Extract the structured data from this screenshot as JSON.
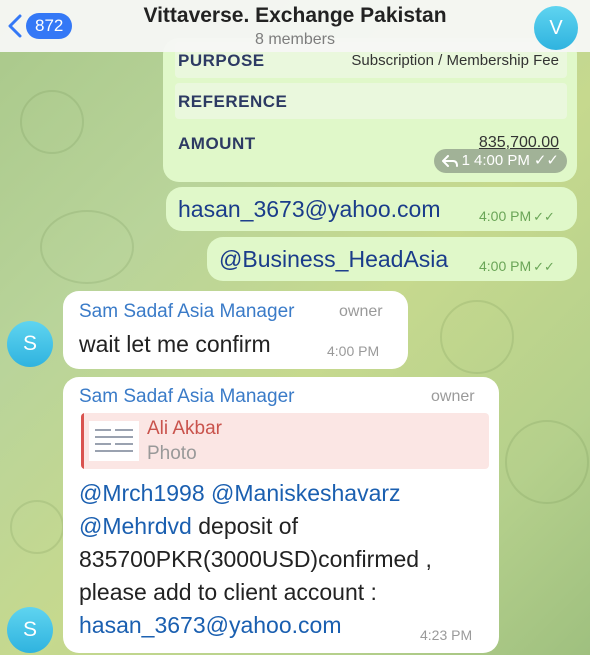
{
  "header": {
    "back_count": "872",
    "title": "Vittaverse. Exchange Pakistan",
    "subtitle": "8 members",
    "avatar_letter": "V"
  },
  "card": {
    "purpose_label": "PURPOSE",
    "purpose_value": "Subscription / Membership Fee",
    "reference_label": "REFERENCE",
    "amount_label": "AMOUNT",
    "amount_value": "835,700.00",
    "reply_count": "1",
    "time": "4:00 PM"
  },
  "outgoing": [
    {
      "text": "hasan_3673@yahoo.com",
      "time": "4:00 PM"
    },
    {
      "text": "@Business_HeadAsia",
      "time": "4:00 PM"
    }
  ],
  "incoming": [
    {
      "sender": "Sam Sadaf Asia Manager",
      "role": "owner",
      "text": "wait let me confirm",
      "time": "4:00 PM",
      "avatar_letter": "S"
    },
    {
      "sender": "Sam Sadaf Asia Manager",
      "role": "owner",
      "reply_name": "Ali Akbar",
      "reply_type": "Photo",
      "mentions": [
        "@Mrch1998",
        "@Maniskeshavarz",
        "@Mehrdvd"
      ],
      "line2_rest": " deposit of",
      "line3": "835700PKR(3000USD)confirmed ,",
      "line4": "please add to client account :",
      "email": "hasan_3673@yahoo.com",
      "time": "4:23 PM",
      "avatar_letter": "S"
    }
  ],
  "colors": {
    "outgoing_bubble": "#e0f8c9",
    "accent_blue": "#3478f6",
    "sender_name": "#3a7bc8",
    "read_check": "#6aa557"
  }
}
